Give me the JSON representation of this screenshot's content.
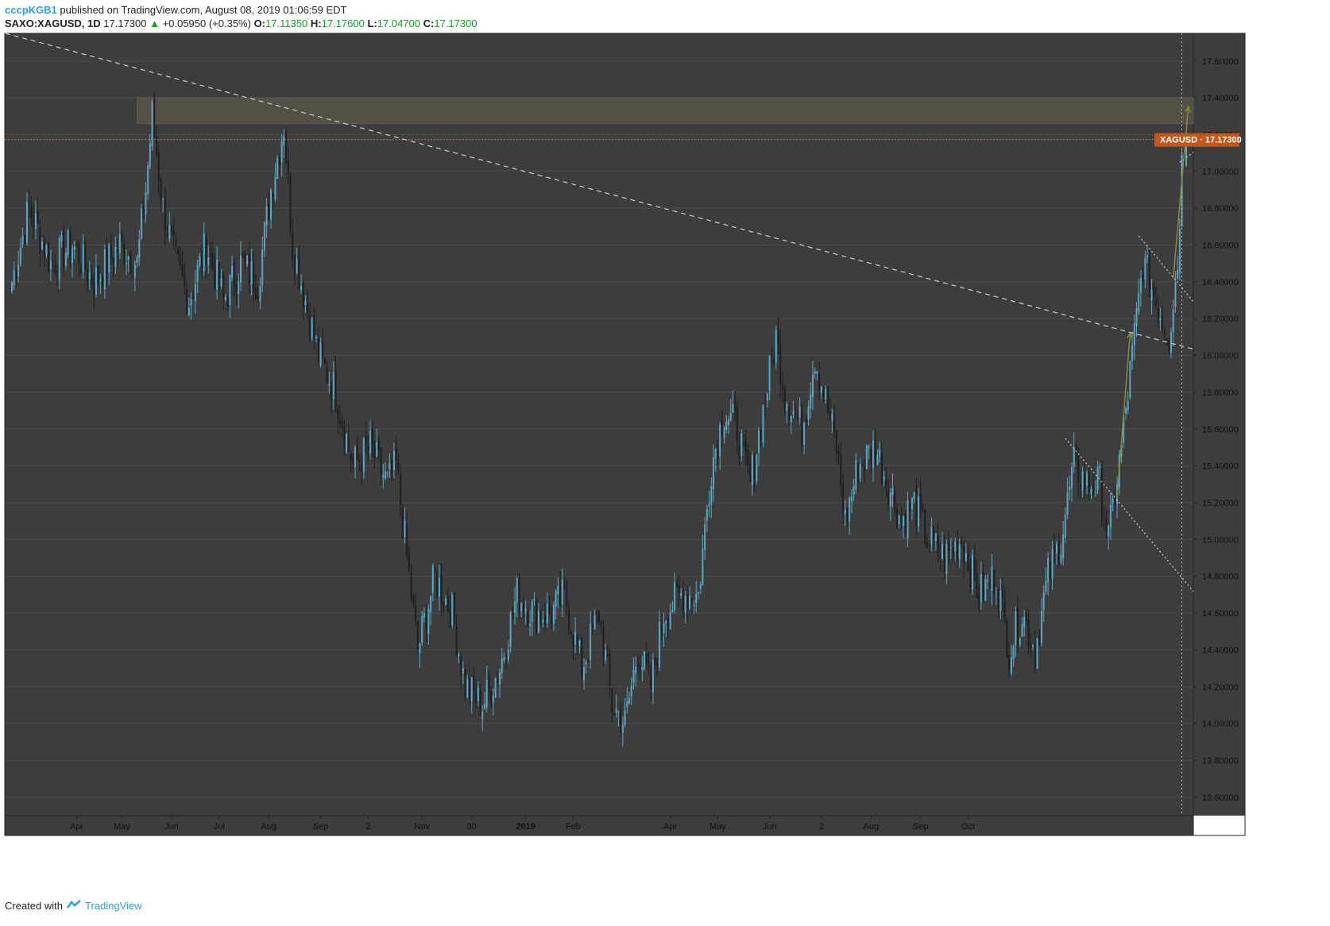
{
  "header": {
    "author": "cccpKGB1",
    "published": "published on TradingView.com, August 08, 2019 01:06:59 EDT",
    "symbol": "SAXO:XAGUSD, 1D",
    "last": "17.17300",
    "change": "+0.05950 (+0.35%)",
    "o_label": "O:",
    "o_value": "17.11350",
    "h_label": "H:",
    "h_value": "17.17600",
    "l_label": "L:",
    "l_value": "17.04700",
    "c_label": "C:",
    "c_value": "17.17300"
  },
  "footer": {
    "created": "Created with",
    "brand": "TradingView"
  },
  "colors": {
    "background": "#3d3d3d",
    "grid": "#4a4a4a",
    "up_candle": "#5aa7c3",
    "down_candle": "#1f1f1f",
    "trendline": "#cfcfcf",
    "arrow": "#8c8a3a",
    "zone": "#5a5448",
    "price_label": "#c1581b"
  },
  "chart_data": {
    "type": "candlestick",
    "symbol": "XAGUSD",
    "ylim": [
      13.5,
      17.75
    ],
    "yticks": [
      "17.60000",
      "17.40000",
      "17.20000",
      "17.00000",
      "16.80000",
      "16.60000",
      "16.40000",
      "16.20000",
      "16.00000",
      "15.80000",
      "15.60000",
      "15.40000",
      "15.20000",
      "15.00000",
      "14.80000",
      "14.60000",
      "14.40000",
      "14.20000",
      "14.00000",
      "13.80000",
      "13.60000"
    ],
    "xticks": [
      "Apr",
      "May",
      "Jun",
      "Jul",
      "Aug",
      "Sep",
      "2",
      "Nov",
      "30",
      "2019",
      "Feb",
      "Apr",
      "May",
      "Jun",
      "2",
      "Aug",
      "Sep",
      "Oct"
    ],
    "current_price_label": "XAGUSD · 17.17300",
    "current_price": 17.173,
    "anchors": [
      [
        0,
        16.4
      ],
      [
        8,
        16.8
      ],
      [
        18,
        16.5
      ],
      [
        28,
        16.6
      ],
      [
        38,
        16.4
      ],
      [
        50,
        16.6
      ],
      [
        58,
        16.5
      ],
      [
        62,
        16.9
      ],
      [
        65,
        17.3
      ],
      [
        70,
        16.8
      ],
      [
        76,
        16.5
      ],
      [
        82,
        16.3
      ],
      [
        90,
        16.6
      ],
      [
        98,
        16.3
      ],
      [
        106,
        16.5
      ],
      [
        114,
        16.4
      ],
      [
        120,
        16.9
      ],
      [
        126,
        17.25
      ],
      [
        130,
        16.6
      ],
      [
        136,
        16.3
      ],
      [
        142,
        16.0
      ],
      [
        150,
        15.8
      ],
      [
        158,
        15.4
      ],
      [
        166,
        15.5
      ],
      [
        174,
        15.3
      ],
      [
        178,
        15.4
      ],
      [
        182,
        15.0
      ],
      [
        188,
        14.4
      ],
      [
        196,
        14.8
      ],
      [
        204,
        14.6
      ],
      [
        210,
        14.2
      ],
      [
        218,
        14.1
      ],
      [
        226,
        14.3
      ],
      [
        234,
        14.7
      ],
      [
        242,
        14.6
      ],
      [
        250,
        14.6
      ],
      [
        256,
        14.7
      ],
      [
        264,
        14.3
      ],
      [
        272,
        14.6
      ],
      [
        278,
        14.1
      ],
      [
        284,
        14.0
      ],
      [
        290,
        14.4
      ],
      [
        296,
        14.2
      ],
      [
        302,
        14.6
      ],
      [
        310,
        14.7
      ],
      [
        318,
        14.7
      ],
      [
        324,
        15.4
      ],
      [
        330,
        15.7
      ],
      [
        336,
        15.6
      ],
      [
        342,
        15.3
      ],
      [
        348,
        15.7
      ],
      [
        354,
        16.1
      ],
      [
        358,
        15.8
      ],
      [
        366,
        15.6
      ],
      [
        372,
        16.0
      ],
      [
        376,
        15.8
      ],
      [
        382,
        15.5
      ],
      [
        386,
        15.1
      ],
      [
        392,
        15.4
      ],
      [
        400,
        15.5
      ],
      [
        406,
        15.3
      ],
      [
        412,
        15.1
      ],
      [
        418,
        15.2
      ],
      [
        424,
        15.0
      ],
      [
        432,
        14.9
      ],
      [
        440,
        15.0
      ],
      [
        448,
        14.7
      ],
      [
        456,
        14.8
      ],
      [
        462,
        14.4
      ],
      [
        468,
        14.6
      ],
      [
        474,
        14.4
      ],
      [
        480,
        14.8
      ],
      [
        486,
        15.0
      ],
      [
        492,
        15.4
      ],
      [
        498,
        15.3
      ],
      [
        504,
        15.3
      ],
      [
        508,
        15.0
      ],
      [
        514,
        15.5
      ],
      [
        520,
        16.1
      ],
      [
        524,
        16.5
      ],
      [
        530,
        16.3
      ],
      [
        536,
        16.1
      ],
      [
        540,
        16.5
      ],
      [
        542,
        17.05
      ],
      [
        544,
        17.173
      ]
    ],
    "n_candles": 545,
    "resistance_zone": [
      17.26,
      17.4
    ],
    "price_line": 17.173,
    "trendlines": [
      {
        "name": "long-downtrend-dashed",
        "from": [
          -3,
          17.75
        ],
        "to": [
          600,
          15.87
        ]
      },
      {
        "name": "short-downtrend-dotted",
        "from": [
          488,
          15.55
        ],
        "to": [
          600,
          13.98
        ]
      },
      {
        "name": "recent-downtrend-dotted",
        "from": [
          522,
          16.65
        ],
        "to": [
          600,
          15.55
        ]
      },
      {
        "name": "projected-uptrend-dotted",
        "from": [
          541,
          17.05
        ],
        "to": [
          600,
          17.55
        ]
      }
    ],
    "arrows": [
      {
        "from": [
          512,
          15.23
        ],
        "to": [
          518,
          16.12
        ]
      },
      {
        "from": [
          538,
          16.42
        ],
        "to": [
          545,
          17.35
        ]
      }
    ],
    "vline_index": 542
  }
}
